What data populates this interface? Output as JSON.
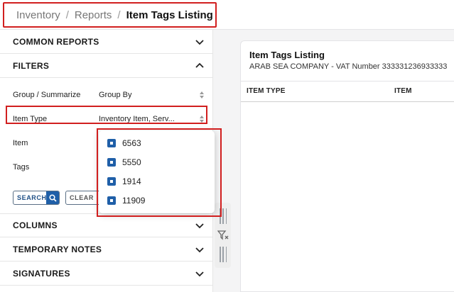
{
  "breadcrumb": {
    "items": [
      "Inventory",
      "Reports"
    ],
    "current": "Item Tags Listing",
    "separator": "/"
  },
  "sidebar": {
    "sections_top": [
      {
        "title": "COMMON REPORTS",
        "icon": "chevron-down-icon"
      },
      {
        "title": "FILTERS",
        "icon": "chevron-up-icon"
      }
    ],
    "filters": {
      "group": {
        "label": "Group / Summarize",
        "value": "Group By"
      },
      "item_type": {
        "label": "Item Type",
        "value": "Inventory Item, Serv..."
      },
      "item": {
        "label": "Item"
      },
      "tags": {
        "label": "Tags"
      }
    },
    "buttons": {
      "search": "SEARCH",
      "clear": "CLEAR"
    },
    "sections_bottom": [
      {
        "title": "COLUMNS",
        "icon": "chevron-down-icon"
      },
      {
        "title": "TEMPORARY NOTES",
        "icon": "chevron-down-icon"
      },
      {
        "title": "SIGNATURES",
        "icon": "chevron-down-icon"
      }
    ]
  },
  "dropdown": {
    "options": [
      "6563",
      "5550",
      "1914",
      "11909"
    ],
    "all_checked": true
  },
  "report": {
    "title": "Item Tags Listing",
    "subtitle": "ARAB SEA COMPANY - VAT Number 333331236933333",
    "columns": [
      "ITEM TYPE",
      "ITEM"
    ]
  },
  "colors": {
    "accent": "#1f5fa8",
    "highlight": "#d11f1f"
  }
}
